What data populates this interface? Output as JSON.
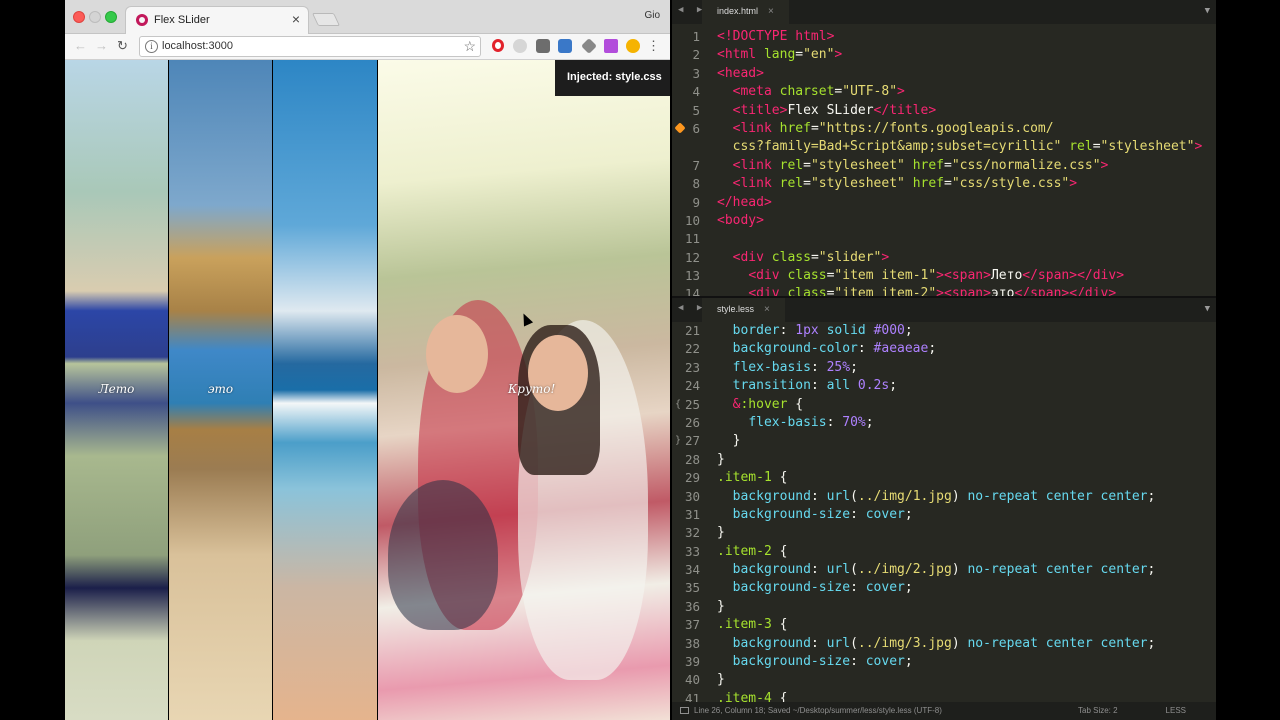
{
  "browser": {
    "tab_title": "Flex SLider",
    "tab_close": "×",
    "profile": "Gio",
    "url": "localhost:3000",
    "nav_back": "←",
    "nav_forward": "→",
    "nav_reload": "↻",
    "star": "☆",
    "menu": "⋮",
    "info": "i",
    "extensions": [
      "opera-icon",
      "ghost-icon",
      "shield-icon",
      "screen-icon",
      "picker-icon",
      "highlighter-icon",
      "weather-icon"
    ]
  },
  "slider": {
    "slides": [
      {
        "label": "Лето"
      },
      {
        "label": "это"
      },
      {
        "label": ""
      },
      {
        "label": "Круто!"
      }
    ]
  },
  "toast": "Injected: style.css",
  "editor": {
    "top": {
      "tab": "index.html",
      "lines": [
        {
          "n": "1",
          "html": "<span class=\"tg\">&lt;!DOCTYPE html&gt;</span>"
        },
        {
          "n": "2",
          "html": "<span class=\"tg\">&lt;html</span> <span class=\"at\">lang</span>=<span class=\"st\">\"en\"</span><span class=\"tg\">&gt;</span>"
        },
        {
          "n": "3",
          "html": "<span class=\"tg\">&lt;head&gt;</span>"
        },
        {
          "n": "4",
          "html": "  <span class=\"tg\">&lt;meta</span> <span class=\"at\">charset</span>=<span class=\"st\">\"UTF-8\"</span><span class=\"tg\">&gt;</span>"
        },
        {
          "n": "5",
          "html": "  <span class=\"tg\">&lt;title&gt;</span>Flex SLider<span class=\"tg\">&lt;/title&gt;</span>"
        },
        {
          "n": "6",
          "marker": true,
          "html": "  <span class=\"tg\">&lt;link</span> <span class=\"at\">href</span>=<span class=\"st\">\"https://fonts.googleapis.com/</span>"
        },
        {
          "n": "",
          "html": "  <span class=\"st\">css?family=Bad+Script&amp;amp;subset=cyrillic\"</span> <span class=\"at\">rel</span>=<span class=\"st\">\"stylesheet\"</span><span class=\"tg\">&gt;</span>"
        },
        {
          "n": "7",
          "html": "  <span class=\"tg\">&lt;link</span> <span class=\"at\">rel</span>=<span class=\"st\">\"stylesheet\"</span> <span class=\"at\">href</span>=<span class=\"st\">\"css/normalize.css\"</span><span class=\"tg\">&gt;</span>"
        },
        {
          "n": "8",
          "html": "  <span class=\"tg\">&lt;link</span> <span class=\"at\">rel</span>=<span class=\"st\">\"stylesheet\"</span> <span class=\"at\">href</span>=<span class=\"st\">\"css/style.css\"</span><span class=\"tg\">&gt;</span>"
        },
        {
          "n": "9",
          "html": "<span class=\"tg\">&lt;/head&gt;</span>"
        },
        {
          "n": "10",
          "html": "<span class=\"tg\">&lt;body&gt;</span>"
        },
        {
          "n": "11",
          "html": ""
        },
        {
          "n": "12",
          "html": "  <span class=\"tg\">&lt;div</span> <span class=\"at\">class</span>=<span class=\"st\">\"slider\"</span><span class=\"tg\">&gt;</span>"
        },
        {
          "n": "13",
          "html": "    <span class=\"tg\">&lt;div</span> <span class=\"at\">class</span>=<span class=\"st\">\"item item-1\"</span><span class=\"tg\">&gt;&lt;span&gt;</span>Лето<span class=\"tg\">&lt;/span&gt;&lt;/div&gt;</span>"
        },
        {
          "n": "14",
          "html": "    <span class=\"tg\">&lt;div</span> <span class=\"at\">class</span>=<span class=\"st\">\"item item-2\"</span><span class=\"tg\">&gt;&lt;span&gt;</span>это<span class=\"tg\">&lt;/span&gt;&lt;/div&gt;</span>"
        }
      ]
    },
    "bottom": {
      "tab": "style.less",
      "lines": [
        {
          "n": "21",
          "html": "  <span class=\"kw\">border</span>: <span class=\"nm\">1px</span> <span class=\"kw\">solid</span> <span class=\"nm\">#000</span>;"
        },
        {
          "n": "22",
          "html": "  <span class=\"kw\">background-color</span>: <span class=\"nm\">#aeaeae</span>;"
        },
        {
          "n": "23",
          "html": "  <span class=\"kw\">flex-basis</span>: <span class=\"nm\">25%</span>;"
        },
        {
          "n": "24",
          "html": "  <span class=\"kw\">transition</span>: <span class=\"kw\">all</span> <span class=\"nm\">0.2s</span>;"
        },
        {
          "n": "25",
          "fold": "{",
          "html": "  <span class=\"tg\">&amp;</span><span class=\"at\">:hover</span> {"
        },
        {
          "n": "26",
          "html": "    <span class=\"kw\">flex-basis</span>: <span class=\"nm\">70%</span>;"
        },
        {
          "n": "27",
          "fold": "}",
          "html": "  }"
        },
        {
          "n": "28",
          "html": "}"
        },
        {
          "n": "29",
          "html": "<span class=\"at\">.item-1</span> {"
        },
        {
          "n": "30",
          "html": "  <span class=\"kw\">background</span>: <span class=\"fn\">url</span>(<span class=\"st\">../img/1.jpg</span>) <span class=\"kw\">no-repeat center center</span>;"
        },
        {
          "n": "31",
          "html": "  <span class=\"kw\">background-size</span>: <span class=\"kw\">cover</span>;"
        },
        {
          "n": "32",
          "html": "}"
        },
        {
          "n": "33",
          "html": "<span class=\"at\">.item-2</span> {"
        },
        {
          "n": "34",
          "html": "  <span class=\"kw\">background</span>: <span class=\"fn\">url</span>(<span class=\"st\">../img/2.jpg</span>) <span class=\"kw\">no-repeat center center</span>;"
        },
        {
          "n": "35",
          "html": "  <span class=\"kw\">background-size</span>: <span class=\"kw\">cover</span>;"
        },
        {
          "n": "36",
          "html": "}"
        },
        {
          "n": "37",
          "html": "<span class=\"at\">.item-3</span> {"
        },
        {
          "n": "38",
          "html": "  <span class=\"kw\">background</span>: <span class=\"fn\">url</span>(<span class=\"st\">../img/3.jpg</span>) <span class=\"kw\">no-repeat center center</span>;"
        },
        {
          "n": "39",
          "html": "  <span class=\"kw\">background-size</span>: <span class=\"kw\">cover</span>;"
        },
        {
          "n": "40",
          "html": "}"
        },
        {
          "n": "41",
          "html": "<span class=\"at\">.item-4</span> {"
        }
      ]
    },
    "status": {
      "position": "Line 26, Column 18; Saved ~/Desktop/summer/less/style.less (UTF-8)",
      "tab_size": "Tab Size: 2",
      "syntax": "LESS"
    },
    "arrows": "◀ ▶",
    "dropdown": "▼",
    "close": "×"
  },
  "colors": {
    "editor_bg": "#272822",
    "tag": "#f92672",
    "attribute": "#a6e22e",
    "string": "#e6db74",
    "keyword": "#66d9ef",
    "number": "#ae81ff"
  }
}
